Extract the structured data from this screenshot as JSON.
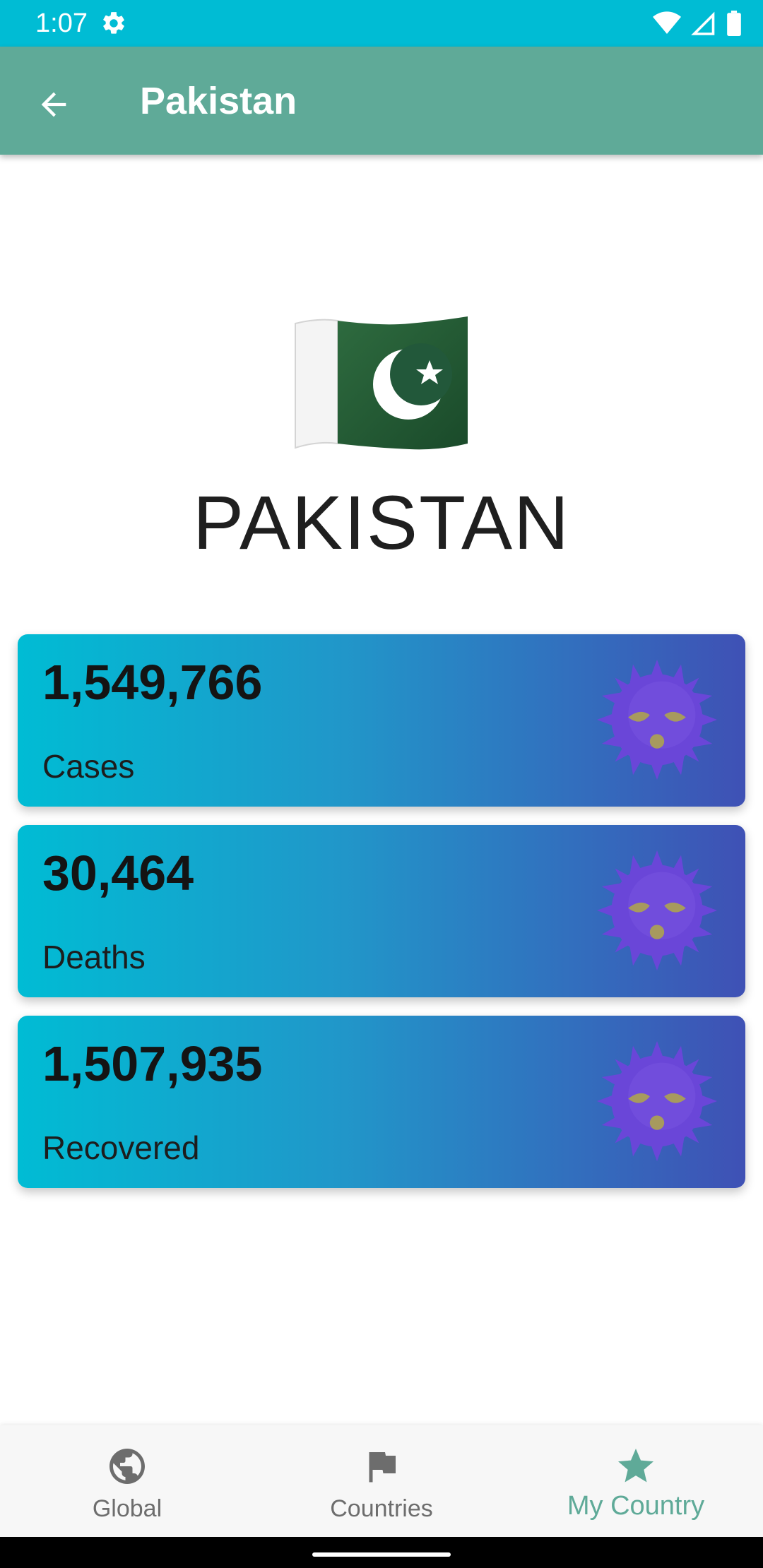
{
  "status_bar": {
    "time": "1:07"
  },
  "app_bar": {
    "title": "Pakistan"
  },
  "country": {
    "name": "PAKISTAN"
  },
  "stats": [
    {
      "value": "1,549,766",
      "label": "Cases"
    },
    {
      "value": "30,464",
      "label": "Deaths"
    },
    {
      "value": "1,507,935",
      "label": "Recovered"
    }
  ],
  "bottom_nav": {
    "items": [
      {
        "label": "Global",
        "icon": "globe-icon"
      },
      {
        "label": "Countries",
        "icon": "flag-icon"
      },
      {
        "label": "My Country",
        "icon": "star-icon"
      }
    ],
    "active_index": 2
  },
  "colors": {
    "status_bar": "#00bcd4",
    "app_bar": "#5faa98",
    "card_gradient_start": "#00bcd4",
    "card_gradient_end": "#3f51b5",
    "nav_active": "#5faa98",
    "nav_inactive": "#6d6d6d"
  }
}
